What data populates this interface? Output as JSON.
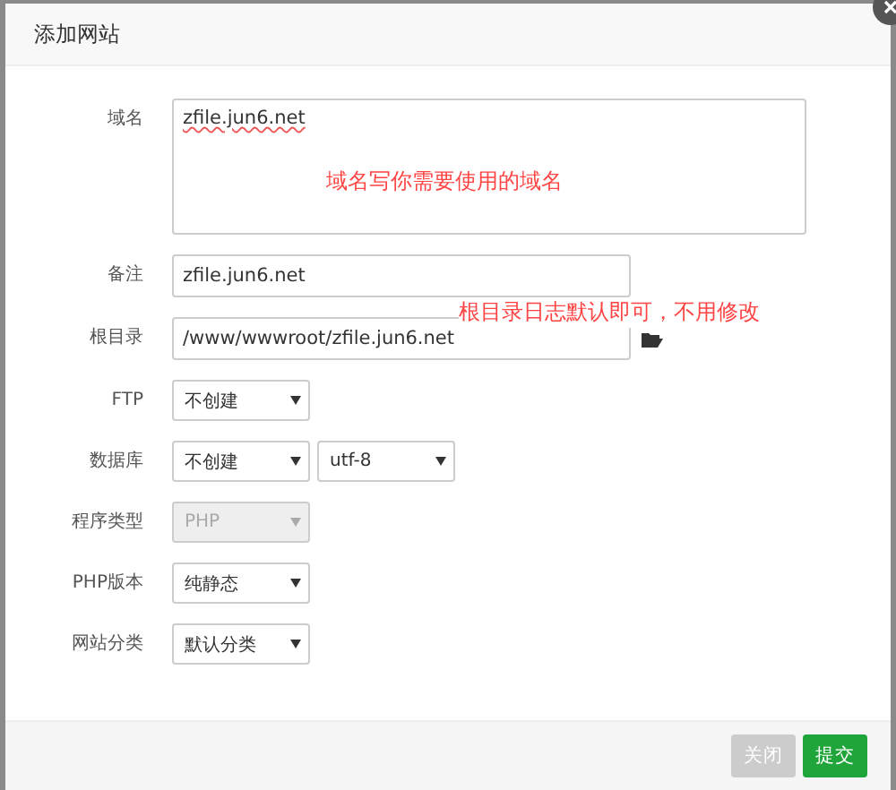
{
  "dialog": {
    "title": "添加网站",
    "fields": [
      {
        "label": "域名",
        "controls": [
          {
            "kind": "textarea",
            "value": "zfile.jun6.net",
            "disabled": false
          }
        ],
        "annotation": "域名写你需要使用的域名"
      },
      {
        "label": "备注",
        "controls": [
          {
            "kind": "input",
            "value": "zfile.jun6.net",
            "disabled": false
          }
        ]
      },
      {
        "label": "根目录",
        "controls": [
          {
            "kind": "path",
            "value": "/www/wwwroot/zfile.jun6.net",
            "disabled": false
          }
        ],
        "annotation": "根目录日志默认即可，不用修改"
      },
      {
        "label": "FTP",
        "controls": [
          {
            "kind": "select",
            "value": "不创建",
            "disabled": false
          }
        ]
      },
      {
        "label": "数据库",
        "controls": [
          {
            "kind": "select",
            "value": "不创建",
            "disabled": false
          },
          {
            "kind": "select",
            "value": "utf-8",
            "disabled": false
          }
        ]
      },
      {
        "label": "程序类型",
        "controls": [
          {
            "kind": "select",
            "value": "PHP",
            "disabled": true
          }
        ]
      },
      {
        "label": "PHP版本",
        "controls": [
          {
            "kind": "select",
            "value": "纯静态",
            "disabled": false
          }
        ]
      },
      {
        "label": "网站分类",
        "controls": [
          {
            "kind": "select",
            "value": "默认分类",
            "disabled": false
          }
        ]
      }
    ],
    "buttons": [
      {
        "label": "关闭",
        "kind": "close",
        "disabled": true
      },
      {
        "label": "提交",
        "kind": "submit",
        "disabled": false
      }
    ]
  }
}
